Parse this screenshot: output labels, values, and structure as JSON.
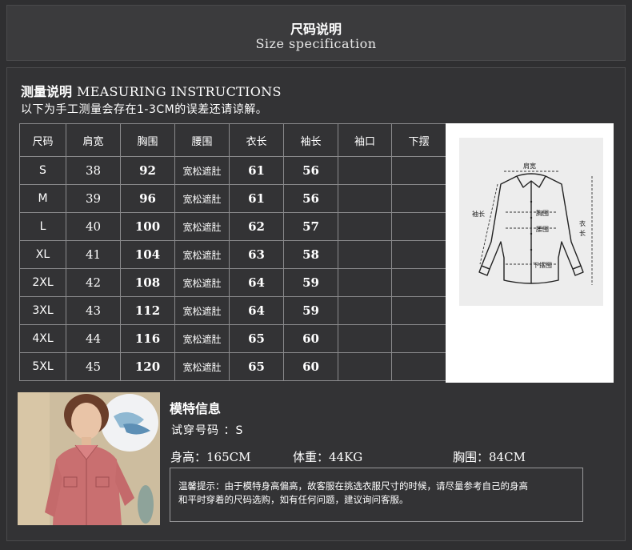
{
  "header": {
    "title_zh": "尺码说明",
    "title_en": "Size specification"
  },
  "measuring": {
    "title_zh": "测量说明",
    "title_en": "MEASURING INSTRUCTIONS",
    "note": "以下为手工测量会存在1-3CM的误差还请谅解。"
  },
  "table": {
    "headers": [
      "尺码",
      "肩宽",
      "胸围",
      "腰围",
      "衣长",
      "袖长",
      "袖口",
      "下摆"
    ],
    "rows": [
      [
        "S",
        "38",
        "92",
        "宽松遮肚",
        "61",
        "56",
        "",
        ""
      ],
      [
        "M",
        "39",
        "96",
        "宽松遮肚",
        "61",
        "56",
        "",
        ""
      ],
      [
        "L",
        "40",
        "100",
        "宽松遮肚",
        "62",
        "57",
        "",
        ""
      ],
      [
        "XL",
        "41",
        "104",
        "宽松遮肚",
        "63",
        "58",
        "",
        ""
      ],
      [
        "2XL",
        "42",
        "108",
        "宽松遮肚",
        "64",
        "59",
        "",
        ""
      ],
      [
        "3XL",
        "43",
        "112",
        "宽松遮肚",
        "64",
        "59",
        "",
        ""
      ],
      [
        "4XL",
        "44",
        "116",
        "宽松遮肚",
        "65",
        "60",
        "",
        ""
      ],
      [
        "5XL",
        "45",
        "120",
        "宽松遮肚",
        "65",
        "60",
        "",
        ""
      ]
    ]
  },
  "diagram": {
    "shoulder": "肩宽",
    "chest": "胸围",
    "waist": "腰围",
    "sleeve": "袖长",
    "length_top": "衣",
    "length_bottom": "长",
    "hem": "下摆围"
  },
  "model": {
    "title": "模特信息",
    "try_size": "试穿号码 ：S",
    "height_label": "身高：",
    "height_value": "165CM",
    "weight_label": "体重：",
    "weight_value": "44KG",
    "bust_label": "胸围：",
    "bust_value": "84CM",
    "notice_line1": "温馨提示：由于模特身高偏高，故客服在挑选衣服尺寸的时候，请尽量参考自己的身高",
    "notice_line2": "和平时穿着的尺码选购，如有任何问题，建议询问客服。"
  },
  "colors": {
    "background": "#2f2f31",
    "header": "#3b3b3d",
    "border": "#8a8a8c",
    "shirt": "#c96f70"
  }
}
